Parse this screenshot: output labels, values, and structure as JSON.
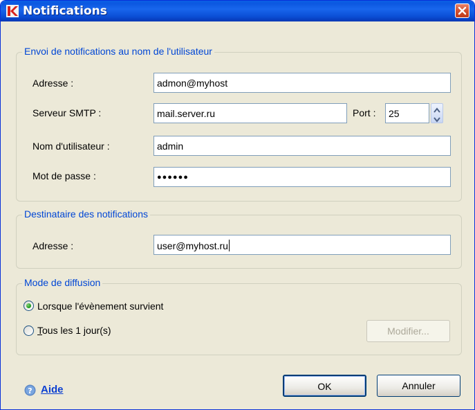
{
  "window": {
    "title": "Notifications"
  },
  "sender": {
    "legend": "Envoi de notifications au nom de l'utilisateur",
    "address_label": "Adresse :",
    "address_value": "admon@myhost",
    "smtp_label": "Serveur  SMTP :",
    "smtp_value": "mail.server.ru",
    "port_label": "Port :",
    "port_value": "25",
    "username_label": "Nom d'utilisateur :",
    "username_value": "admin",
    "password_label": "Mot de passe :",
    "password_value": "●●●●●●"
  },
  "recipient": {
    "legend": "Destinataire des notifications",
    "address_label": "Adresse :",
    "address_value": "user@myhost.ru"
  },
  "mode": {
    "legend": "Mode de diffusion",
    "option_event": "Lorsque l'évènement survient",
    "option_daily_mnemonic": "T",
    "option_daily_rest": "ous les 1 jour(s)",
    "selected": "event",
    "modify_label": "Modifier..."
  },
  "footer": {
    "help_label": "Aide",
    "ok_label": "OK",
    "cancel_label": "Annuler"
  },
  "colors": {
    "titlebar": "#0b4fd7",
    "legend": "#0046d5",
    "close": "#d4512f",
    "radio_dot": "#21a121"
  }
}
